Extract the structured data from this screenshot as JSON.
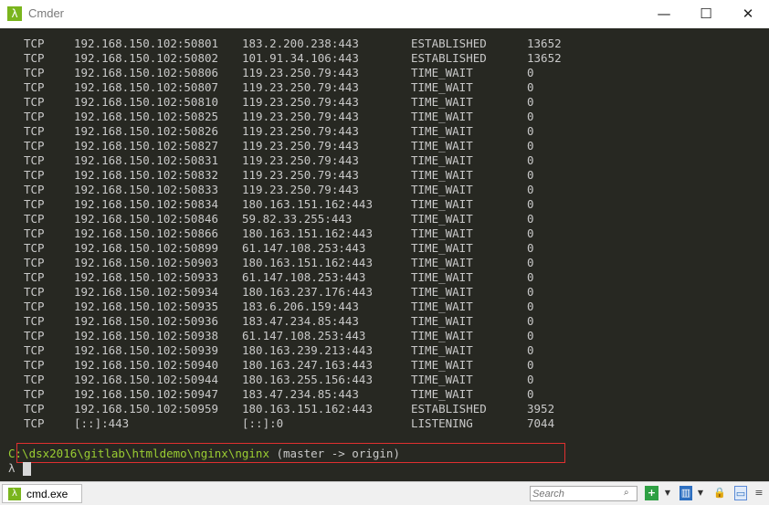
{
  "window": {
    "title": "Cmder",
    "app_icon": "λ",
    "minimize": "—",
    "maximize": "☐",
    "close": "✕"
  },
  "netstat": {
    "rows": [
      {
        "proto": "TCP",
        "local": "192.168.150.102:50801",
        "foreign": "183.2.200.238:443",
        "state": "ESTABLISHED",
        "pid": "13652"
      },
      {
        "proto": "TCP",
        "local": "192.168.150.102:50802",
        "foreign": "101.91.34.106:443",
        "state": "ESTABLISHED",
        "pid": "13652"
      },
      {
        "proto": "TCP",
        "local": "192.168.150.102:50806",
        "foreign": "119.23.250.79:443",
        "state": "TIME_WAIT",
        "pid": "0"
      },
      {
        "proto": "TCP",
        "local": "192.168.150.102:50807",
        "foreign": "119.23.250.79:443",
        "state": "TIME_WAIT",
        "pid": "0"
      },
      {
        "proto": "TCP",
        "local": "192.168.150.102:50810",
        "foreign": "119.23.250.79:443",
        "state": "TIME_WAIT",
        "pid": "0"
      },
      {
        "proto": "TCP",
        "local": "192.168.150.102:50825",
        "foreign": "119.23.250.79:443",
        "state": "TIME_WAIT",
        "pid": "0"
      },
      {
        "proto": "TCP",
        "local": "192.168.150.102:50826",
        "foreign": "119.23.250.79:443",
        "state": "TIME_WAIT",
        "pid": "0"
      },
      {
        "proto": "TCP",
        "local": "192.168.150.102:50827",
        "foreign": "119.23.250.79:443",
        "state": "TIME_WAIT",
        "pid": "0"
      },
      {
        "proto": "TCP",
        "local": "192.168.150.102:50831",
        "foreign": "119.23.250.79:443",
        "state": "TIME_WAIT",
        "pid": "0"
      },
      {
        "proto": "TCP",
        "local": "192.168.150.102:50832",
        "foreign": "119.23.250.79:443",
        "state": "TIME_WAIT",
        "pid": "0"
      },
      {
        "proto": "TCP",
        "local": "192.168.150.102:50833",
        "foreign": "119.23.250.79:443",
        "state": "TIME_WAIT",
        "pid": "0"
      },
      {
        "proto": "TCP",
        "local": "192.168.150.102:50834",
        "foreign": "180.163.151.162:443",
        "state": "TIME_WAIT",
        "pid": "0"
      },
      {
        "proto": "TCP",
        "local": "192.168.150.102:50846",
        "foreign": "59.82.33.255:443",
        "state": "TIME_WAIT",
        "pid": "0"
      },
      {
        "proto": "TCP",
        "local": "192.168.150.102:50866",
        "foreign": "180.163.151.162:443",
        "state": "TIME_WAIT",
        "pid": "0"
      },
      {
        "proto": "TCP",
        "local": "192.168.150.102:50899",
        "foreign": "61.147.108.253:443",
        "state": "TIME_WAIT",
        "pid": "0"
      },
      {
        "proto": "TCP",
        "local": "192.168.150.102:50903",
        "foreign": "180.163.151.162:443",
        "state": "TIME_WAIT",
        "pid": "0"
      },
      {
        "proto": "TCP",
        "local": "192.168.150.102:50933",
        "foreign": "61.147.108.253:443",
        "state": "TIME_WAIT",
        "pid": "0"
      },
      {
        "proto": "TCP",
        "local": "192.168.150.102:50934",
        "foreign": "180.163.237.176:443",
        "state": "TIME_WAIT",
        "pid": "0"
      },
      {
        "proto": "TCP",
        "local": "192.168.150.102:50935",
        "foreign": "183.6.206.159:443",
        "state": "TIME_WAIT",
        "pid": "0"
      },
      {
        "proto": "TCP",
        "local": "192.168.150.102:50936",
        "foreign": "183.47.234.85:443",
        "state": "TIME_WAIT",
        "pid": "0"
      },
      {
        "proto": "TCP",
        "local": "192.168.150.102:50938",
        "foreign": "61.147.108.253:443",
        "state": "TIME_WAIT",
        "pid": "0"
      },
      {
        "proto": "TCP",
        "local": "192.168.150.102:50939",
        "foreign": "180.163.239.213:443",
        "state": "TIME_WAIT",
        "pid": "0"
      },
      {
        "proto": "TCP",
        "local": "192.168.150.102:50940",
        "foreign": "180.163.247.163:443",
        "state": "TIME_WAIT",
        "pid": "0"
      },
      {
        "proto": "TCP",
        "local": "192.168.150.102:50944",
        "foreign": "180.163.255.156:443",
        "state": "TIME_WAIT",
        "pid": "0"
      },
      {
        "proto": "TCP",
        "local": "192.168.150.102:50947",
        "foreign": "183.47.234.85:443",
        "state": "TIME_WAIT",
        "pid": "0"
      },
      {
        "proto": "TCP",
        "local": "192.168.150.102:50959",
        "foreign": "180.163.151.162:443",
        "state": "ESTABLISHED",
        "pid": "3952"
      },
      {
        "proto": "TCP",
        "local": "[::]:443",
        "foreign": "[::]:0",
        "state": "LISTENING",
        "pid": "7044"
      }
    ],
    "highlight_color": "#e03030"
  },
  "prompt": {
    "path": "C:\\dsx2016\\gitlab\\htmldemo\\nginx\\nginx",
    "branch": " (master -> origin)",
    "symbol": "λ"
  },
  "statusbar": {
    "tab_label": "cmd.exe",
    "tab_icon": "λ",
    "search_placeholder": "Search",
    "search_icon": "⌕",
    "add_icon": "+",
    "dropdown_icon": "▼",
    "layout_icon": "▥",
    "lock_icon": "🔒",
    "pane_icon": "▭",
    "menu_icon": "≡"
  },
  "colors": {
    "console_bg": "#272822",
    "console_text": "#c9c9c9",
    "path_color": "#9acd32"
  }
}
